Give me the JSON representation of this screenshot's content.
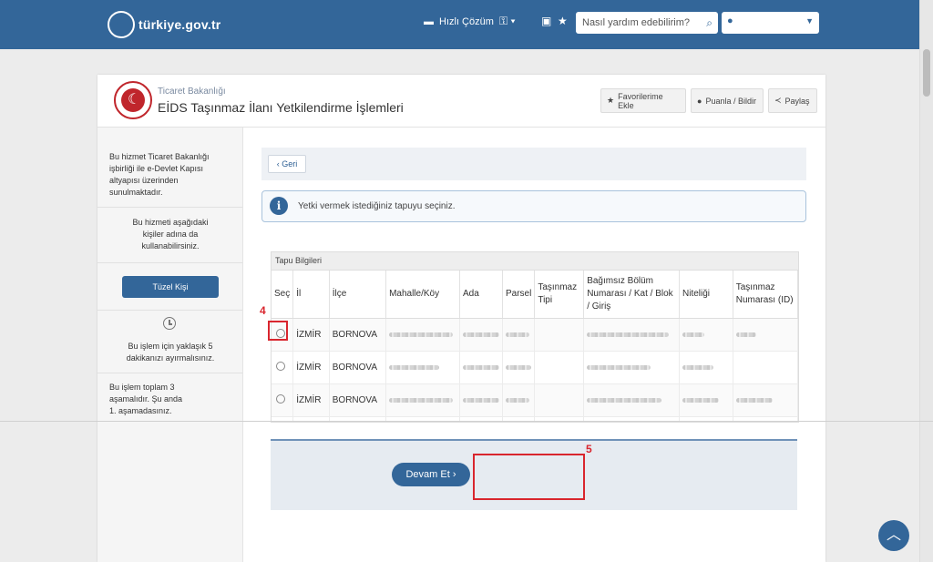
{
  "header": {
    "logo_text": "türkiye.gov.tr",
    "quick_solution": "Hızlı Çözüm",
    "search_placeholder": "Nasıl yardım edebilirim?"
  },
  "service": {
    "ministry": "Ticaret Bakanlığı",
    "title": "EİDS Taşınmaz İlanı Yetkilendirme İşlemleri",
    "buttons": {
      "favorite": "Favorilerime Ekle",
      "rate": "Puanla / Bildir",
      "share": "Paylaş"
    }
  },
  "sidebar": {
    "provider_text": "Bu hizmet Ticaret Bakanlığı işbirliği ile e-Devlet Kapısı altyapısı üzerinden sunulmaktadır.",
    "behalf_text": "Bu hizmeti aşağıdaki kişiler adına da kullanabilirsiniz.",
    "legal_entity_button": "Tüzel Kişi",
    "time_text": "Bu işlem için yaklaşık 5 dakikanızı ayırmalısınız.",
    "steps_text": "Bu işlem toplam 3 aşamalıdır. Şu anda 1. aşamadasınız."
  },
  "content": {
    "back_label": "Geri",
    "info_text": "Yetki vermek istediğiniz tapuyu seçiniz.",
    "table_caption": "Tapu Bilgileri",
    "columns": [
      "Seç",
      "İl",
      "İlçe",
      "Mahalle/Köy",
      "Ada",
      "Parsel",
      "Taşınmaz Tipi",
      "Bağımsız Bölüm Numarası / Kat / Blok / Giriş",
      "Niteliği",
      "Taşınmaz Numarası (ID)"
    ],
    "rows": [
      {
        "il": "İZMİR",
        "ilce": "BORNOVA"
      },
      {
        "il": "İZMİR",
        "ilce": "BORNOVA"
      },
      {
        "il": "İZMİR",
        "ilce": "BORNOVA"
      }
    ],
    "continue_label": "Devam Et"
  },
  "annotations": {
    "step4": "4",
    "step5": "5"
  }
}
